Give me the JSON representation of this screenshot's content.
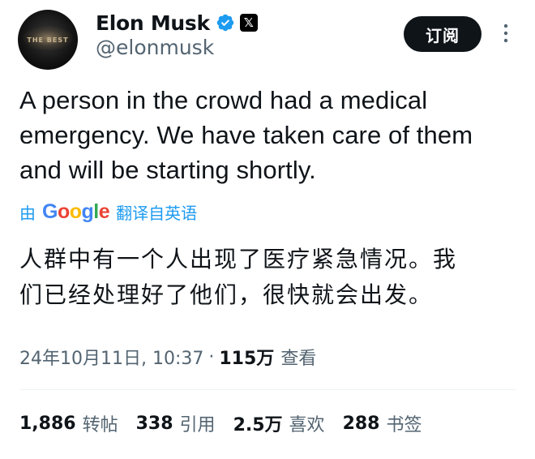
{
  "author": {
    "display_name": "Elon Musk",
    "handle": "@elonmusk",
    "avatar_text": "THE BEST",
    "verified_color": "#1d9bf0"
  },
  "header": {
    "subscribe_label": "订阅",
    "x_badge": "𝕏"
  },
  "tweet": {
    "text_lines": [
      "A person in the crowd had a medical",
      "emergency. We have taken care of them",
      "and will be starting shortly."
    ]
  },
  "translation": {
    "by_label": "由",
    "provider_letters": [
      "G",
      "o",
      "o",
      "g",
      "l",
      "e"
    ],
    "from_label": "翻译自英语",
    "text_lines": [
      "人群中有一个人出现了医疗紧急情况。我",
      "们已经处理好了他们，很快就会出发。"
    ]
  },
  "meta": {
    "timestamp": "24年10月11日, 10:37",
    "separator": "·",
    "views_value": "115万",
    "views_label": "查看"
  },
  "stats": {
    "reposts_value": "1,886",
    "reposts_label": "转帖",
    "quotes_value": "338",
    "quotes_label": "引用",
    "likes_value": "2.5万",
    "likes_label": "喜欢",
    "bookmarks_value": "288",
    "bookmarks_label": "书签"
  },
  "colors": {
    "accent": "#1d9bf0",
    "text": "#0f1419",
    "secondary": "#536471"
  }
}
